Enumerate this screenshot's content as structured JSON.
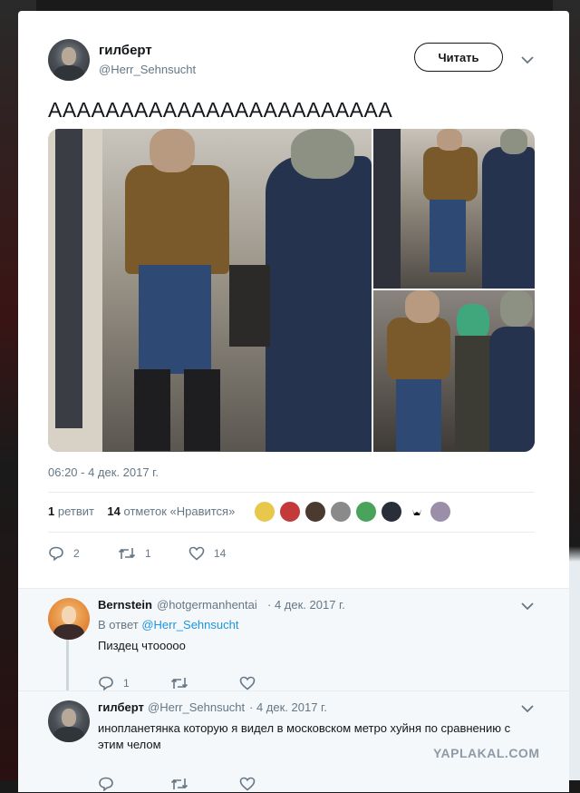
{
  "tweet": {
    "author_name": "гилберт",
    "author_handle": "@Herr_Sehnsucht",
    "follow_label": "Читать",
    "text": "АААААААААААААААААААААААА",
    "timestamp": "06:20 - 4 дек. 2017 г.",
    "retweets_count": "1",
    "retweets_label": "ретвит",
    "likes_count": "14",
    "likes_label": "отметок «Нравится»",
    "actions": {
      "reply_count": "2",
      "retweet_count": "1",
      "like_count": "14"
    }
  },
  "replies": [
    {
      "author_name": "Bernstein",
      "author_handle": "@hotgermanhentai",
      "date": "· 4 дек. 2017 г.",
      "reply_to_prefix": "В ответ",
      "reply_to_handle": "@Herr_Sehnsucht",
      "text": "Пиздец чтооооо",
      "reply_count": "1"
    },
    {
      "author_name": "гилберт",
      "author_handle": "@Herr_Sehnsucht",
      "date": "· 4 дек. 2017 г.",
      "text_line1": "инопланетянка которую я видел в московском метро хуйня по сравнению с",
      "text_line2": "этим челом"
    }
  ],
  "watermark": "YAPLAKAL.COM",
  "colors": {
    "link": "#1b95e0",
    "secondary_text": "#657786",
    "primary_text": "#14171a"
  }
}
